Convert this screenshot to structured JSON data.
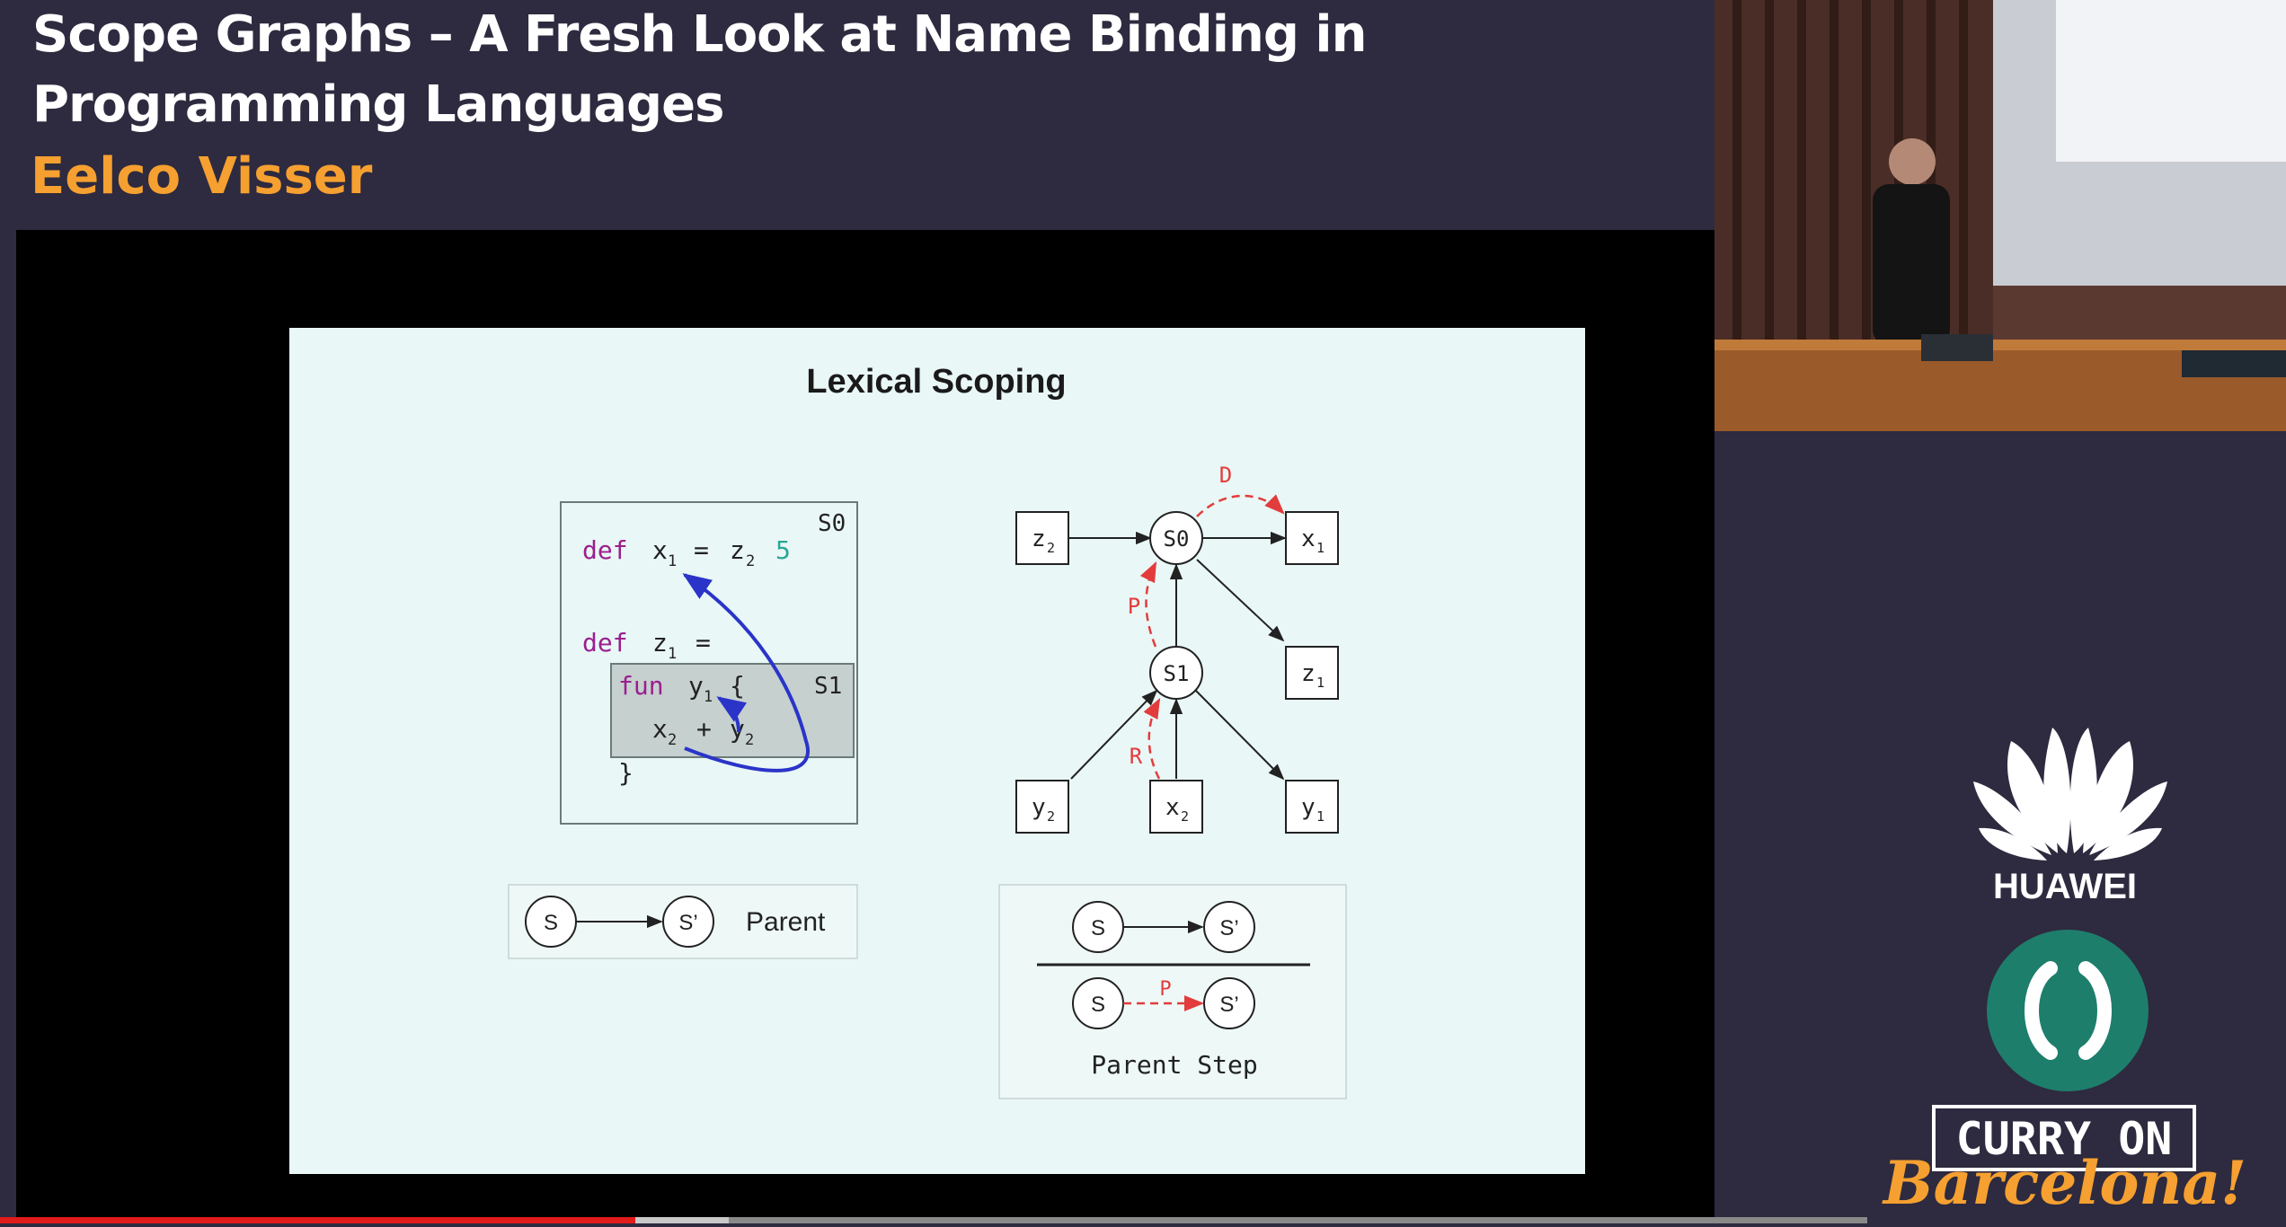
{
  "header": {
    "title": "Scope Graphs – A Fresh Look at Name Binding in Programming Languages",
    "speaker": "Eelco Visser"
  },
  "slide": {
    "title": "Lexical Scoping",
    "code": {
      "scope_outer": "S0",
      "scope_inner": "S1",
      "kw_def": "def",
      "kw_fun": "fun",
      "x": "x",
      "z": "z",
      "y": "y",
      "eq": "=",
      "plus": "+",
      "open_brace": "{",
      "close_brace": "}",
      "literal": "5",
      "sub1": "1",
      "sub2": "2"
    },
    "graph": {
      "scope_nodes": [
        "S0",
        "S1"
      ],
      "edge_labels": {
        "declaration": "D",
        "parent": "P",
        "reference": "R"
      }
    },
    "legend": {
      "node_s": "S",
      "node_s_prime": "S’",
      "parent_label": "Parent",
      "step_edge_label": "P",
      "parent_step_label": "Parent Step"
    }
  },
  "sidebar": {
    "sponsor": "HUAWEI",
    "conference": "CURRY ON",
    "city": "Barcelona!"
  },
  "player": {
    "progress_played": 0.34,
    "progress_buffered": 0.39
  },
  "colors": {
    "background": "#2e2a3f",
    "speaker_accent": "#f5a030",
    "keyword": "#9b1f8f",
    "literal": "#2aa796",
    "binding_arrow": "#2a34c9",
    "dashed_edge": "#e23c3c",
    "curry_teal": "#1e7e6c",
    "progress": "#e21b1b"
  }
}
